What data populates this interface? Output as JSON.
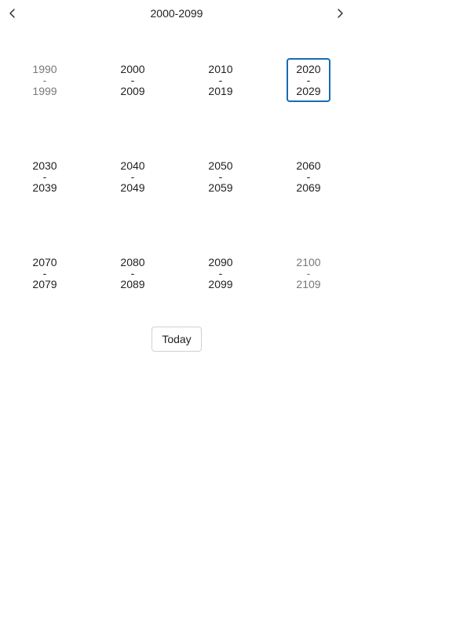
{
  "header": {
    "title": "2000-2099",
    "prev_icon": "chevron-left-icon",
    "next_icon": "chevron-right-icon"
  },
  "decades": [
    {
      "start": "1990",
      "sep": "-",
      "end": "1999",
      "outside": true,
      "selected": false
    },
    {
      "start": "2000",
      "sep": "-",
      "end": "2009",
      "outside": false,
      "selected": false
    },
    {
      "start": "2010",
      "sep": "-",
      "end": "2019",
      "outside": false,
      "selected": false
    },
    {
      "start": "2020",
      "sep": "-",
      "end": "2029",
      "outside": false,
      "selected": true
    },
    {
      "start": "2030",
      "sep": "-",
      "end": "2039",
      "outside": false,
      "selected": false
    },
    {
      "start": "2040",
      "sep": "-",
      "end": "2049",
      "outside": false,
      "selected": false
    },
    {
      "start": "2050",
      "sep": "-",
      "end": "2059",
      "outside": false,
      "selected": false
    },
    {
      "start": "2060",
      "sep": "-",
      "end": "2069",
      "outside": false,
      "selected": false
    },
    {
      "start": "2070",
      "sep": "-",
      "end": "2079",
      "outside": false,
      "selected": false
    },
    {
      "start": "2080",
      "sep": "-",
      "end": "2089",
      "outside": false,
      "selected": false
    },
    {
      "start": "2090",
      "sep": "-",
      "end": "2099",
      "outside": false,
      "selected": false
    },
    {
      "start": "2100",
      "sep": "-",
      "end": "2109",
      "outside": true,
      "selected": false
    }
  ],
  "footer": {
    "today_label": "Today"
  },
  "colors": {
    "selected_border": "#1a6bb0",
    "outside_text": "#777777",
    "text": "#1f1f1f"
  }
}
